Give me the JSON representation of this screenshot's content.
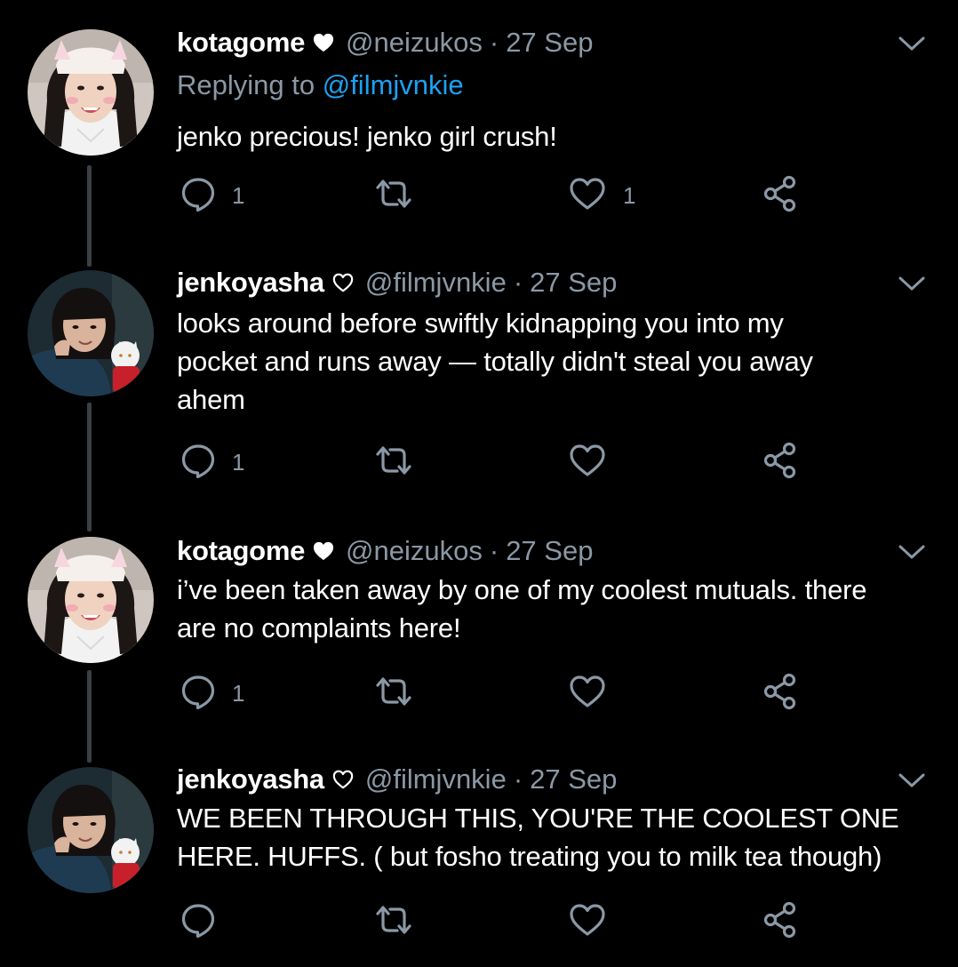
{
  "colors": {
    "background": "#000000",
    "text": "#ffffff",
    "secondary": "#8b98a5",
    "link": "#1da1f2",
    "thread_line": "#3a3f44"
  },
  "icons": {
    "reply": "speech-bubble-icon",
    "retweet": "retweet-arrows-icon",
    "like": "heart-outline-icon",
    "share": "share-nodes-icon",
    "caret": "chevron-down-icon"
  },
  "tweets": [
    {
      "name": "kotagome",
      "name_heart": "filled",
      "handle": "@neizukos",
      "separator": "·",
      "date": "27 Sep",
      "replying_prefix": "Replying to ",
      "replying_to": "@filmjvnkie",
      "text": "jenko precious! jenko girl crush!",
      "reply_count": "1",
      "like_count": "1"
    },
    {
      "name": "jenkoyasha",
      "name_heart": "outline",
      "handle": "@filmjvnkie",
      "separator": "·",
      "date": "27 Sep",
      "text_lines": [
        "looks around before swiftly kidnapping you into my",
        "pocket and runs away — totally didn't steal you away",
        "ahem"
      ],
      "reply_count": "1",
      "like_count": ""
    },
    {
      "name": "kotagome",
      "name_heart": "filled",
      "handle": "@neizukos",
      "separator": "·",
      "date": "27 Sep",
      "text_lines": [
        "i’ve been taken away by one of my coolest mutuals. there",
        "are no complaints here!"
      ],
      "reply_count": "1",
      "like_count": ""
    },
    {
      "name": "jenkoyasha",
      "name_heart": "outline",
      "handle": "@filmjvnkie",
      "separator": "·",
      "date": "27 Sep",
      "text_lines": [
        "WE BEEN THROUGH THIS, YOU'RE THE COOLEST ONE",
        "HERE. HUFFS. ( but fosho treating you to milk tea though)"
      ],
      "reply_count": "",
      "like_count": ""
    }
  ]
}
